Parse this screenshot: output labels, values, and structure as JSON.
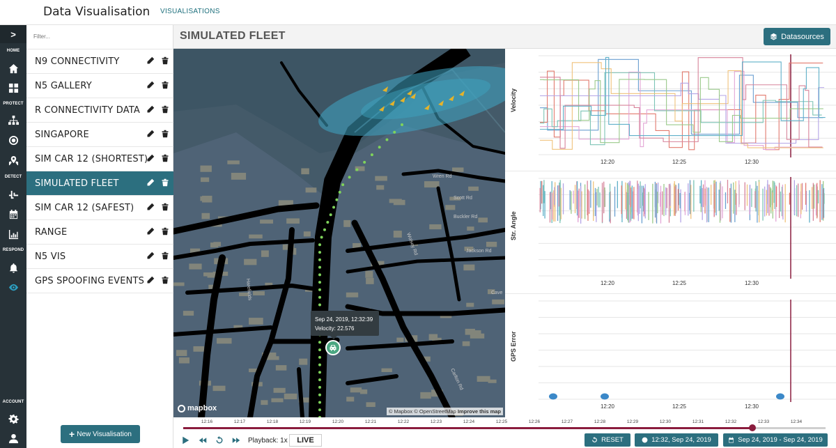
{
  "app": {
    "title": "Data Visualisation",
    "top_tab": "VISUALISATIONS"
  },
  "rail": {
    "expand_label": ">",
    "sections": {
      "home": "HOME",
      "protect": "PROTECT",
      "detect": "DETECT",
      "respond": "RESPOND",
      "account": "ACCOUNT"
    },
    "icons": [
      "home-icon",
      "dashboard-icon",
      "network-icon",
      "target-icon",
      "map-pin-icon",
      "pulse-icon",
      "calendar-icon",
      "bar-chart-icon",
      "bell-icon",
      "eye-icon",
      "gear-icon",
      "user-icon"
    ]
  },
  "sidebar": {
    "filter_placeholder": "Filter...",
    "items": [
      {
        "label": "N9 CONNECTIVITY"
      },
      {
        "label": "N5 GALLERY"
      },
      {
        "label": "R CONNECTIVITY DATA"
      },
      {
        "label": "SINGAPORE"
      },
      {
        "label": "SIM CAR 12 (SHORTEST)"
      },
      {
        "label": "SIMULATED FLEET",
        "active": true
      },
      {
        "label": "SIM CAR 12 (SAFEST)"
      },
      {
        "label": "RANGE"
      },
      {
        "label": "N5 VIS"
      },
      {
        "label": "GPS SPOOFING EVENTS"
      }
    ],
    "new_button": "New Visualisation"
  },
  "header": {
    "title": "SIMULATED FLEET",
    "datasources_label": "Datasources"
  },
  "map": {
    "tooltip_time": "Sep 24, 2019, 12:32:39",
    "tooltip_velocity": "Velocity: 22.576",
    "street_labels": [
      "Wren Rd",
      "Scott Rd",
      "Buckler Rd",
      "Jackson Rd",
      "Wolsey Rd",
      "Harefields",
      "Carlton Rd",
      "Cave"
    ],
    "logo": "mapbox",
    "attribution_1": "© Mapbox © OpenStreetMap",
    "attribution_2": "Improve this map",
    "colors": {
      "water": "#445a69",
      "land": "#52657a",
      "road": "#000000",
      "route_dot": "#7fd35b",
      "zone": "#3fa6c4",
      "arrow": "#e6b32a"
    }
  },
  "charts": [
    {
      "label": "Velocity",
      "x_ticks": [
        "12:20",
        "12:25",
        "12:30"
      ]
    },
    {
      "label": "Str. Angle",
      "x_ticks": [
        "12:20",
        "12:25",
        "12:30"
      ]
    },
    {
      "label": "GPS Error",
      "x_ticks": [
        "12:20",
        "12:25",
        "12:30"
      ]
    }
  ],
  "timeline": {
    "ticks": [
      "12:16",
      "12:17",
      "12:18",
      "12:19",
      "12:20",
      "12:21",
      "12:22",
      "12:23",
      "12:24",
      "12:25",
      "12:26",
      "12:27",
      "12:28",
      "12:29",
      "12:30",
      "12:31",
      "12:32",
      "12:33",
      "12:34"
    ],
    "progress": 0.886,
    "playback_label": "Playback: 1x",
    "live_label": "LIVE",
    "reset_label": "RESET",
    "current_time": "12:32, Sep 24, 2019",
    "date_range": "Sep 24, 2019 - Sep 24, 2019",
    "accent": "#8a1c3d"
  },
  "accent": "#2c6f7f"
}
